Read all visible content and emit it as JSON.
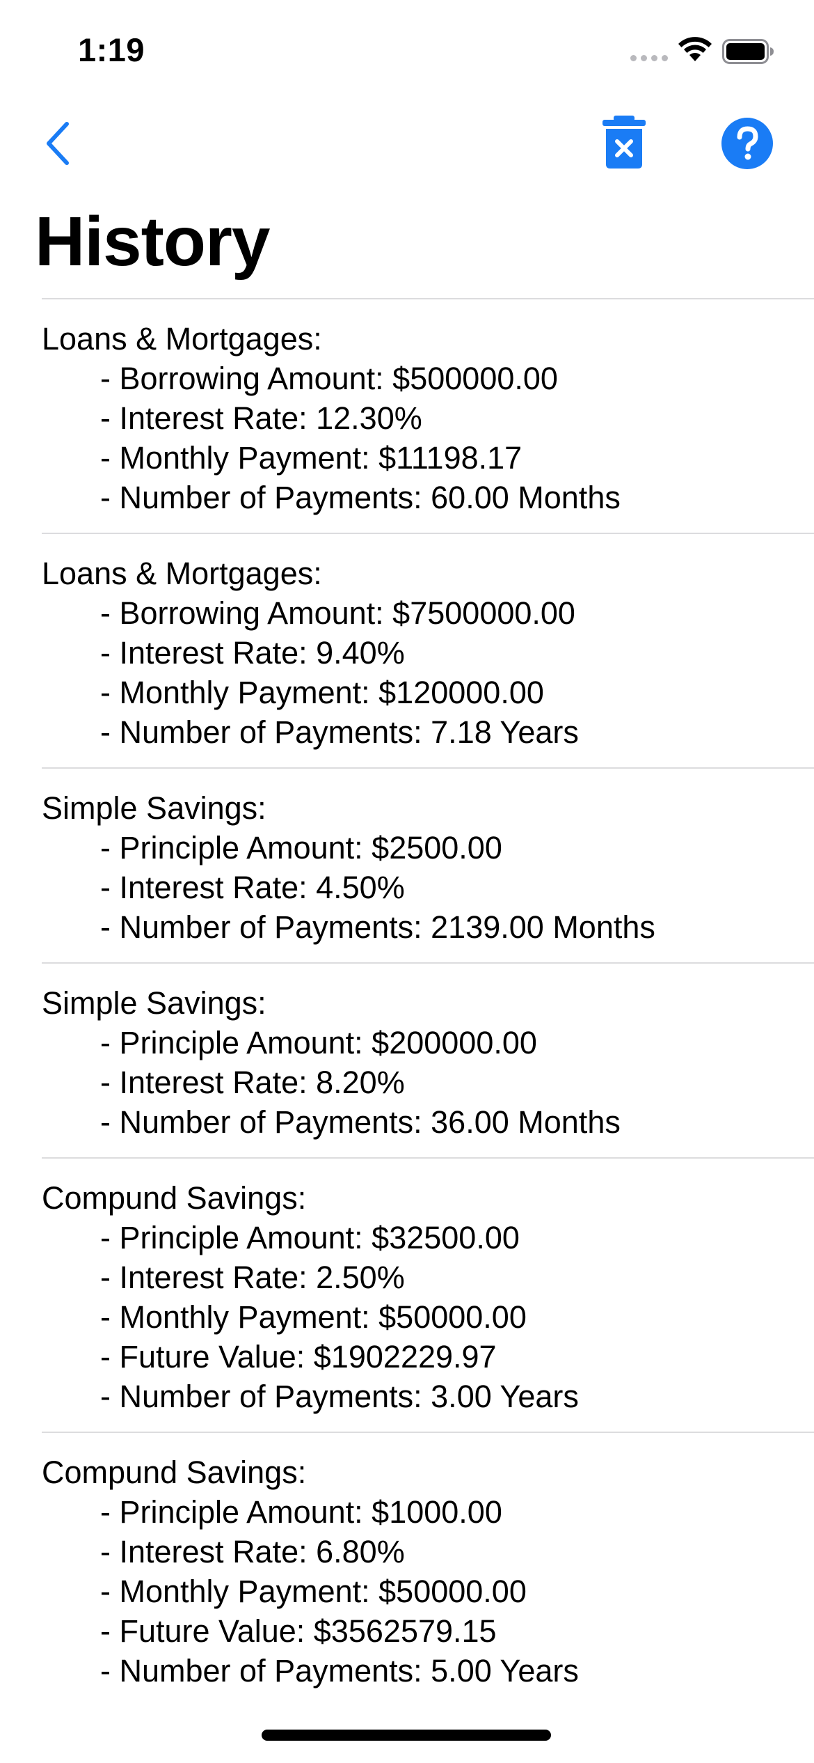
{
  "status_bar": {
    "time": "1:19"
  },
  "nav": {
    "back_icon": "chevron-left-icon",
    "trash_icon": "trash-x-icon",
    "help_icon": "question-circle-icon",
    "accent_color": "#1a7cf5"
  },
  "page": {
    "title": "History"
  },
  "history": [
    {
      "title": "Loans & Mortgages:",
      "lines": [
        "- Borrowing Amount: $500000.00",
        "- Interest Rate: 12.30%",
        "- Monthly Payment: $11198.17",
        "- Number of Payments: 60.00 Months"
      ]
    },
    {
      "title": "Loans & Mortgages:",
      "lines": [
        "- Borrowing Amount: $7500000.00",
        "- Interest Rate: 9.40%",
        "- Monthly Payment: $120000.00",
        "- Number of Payments: 7.18 Years"
      ]
    },
    {
      "title": "Simple Savings:",
      "lines": [
        "- Principle Amount: $2500.00",
        "- Interest Rate: 4.50%",
        "- Number of Payments: 2139.00 Months"
      ]
    },
    {
      "title": "Simple Savings:",
      "lines": [
        "- Principle Amount: $200000.00",
        "- Interest Rate: 8.20%",
        "- Number of Payments: 36.00 Months"
      ]
    },
    {
      "title": "Compund Savings:",
      "lines": [
        "- Principle Amount: $32500.00",
        "- Interest Rate: 2.50%",
        "- Monthly Payment: $50000.00",
        "- Future Value: $1902229.97",
        "- Number of Payments: 3.00 Years"
      ]
    },
    {
      "title": "Compund Savings:",
      "lines": [
        "- Principle Amount: $1000.00",
        "- Interest Rate: 6.80%",
        "- Monthly Payment: $50000.00",
        "- Future Value: $3562579.15",
        "- Number of Payments: 5.00 Years"
      ]
    }
  ]
}
